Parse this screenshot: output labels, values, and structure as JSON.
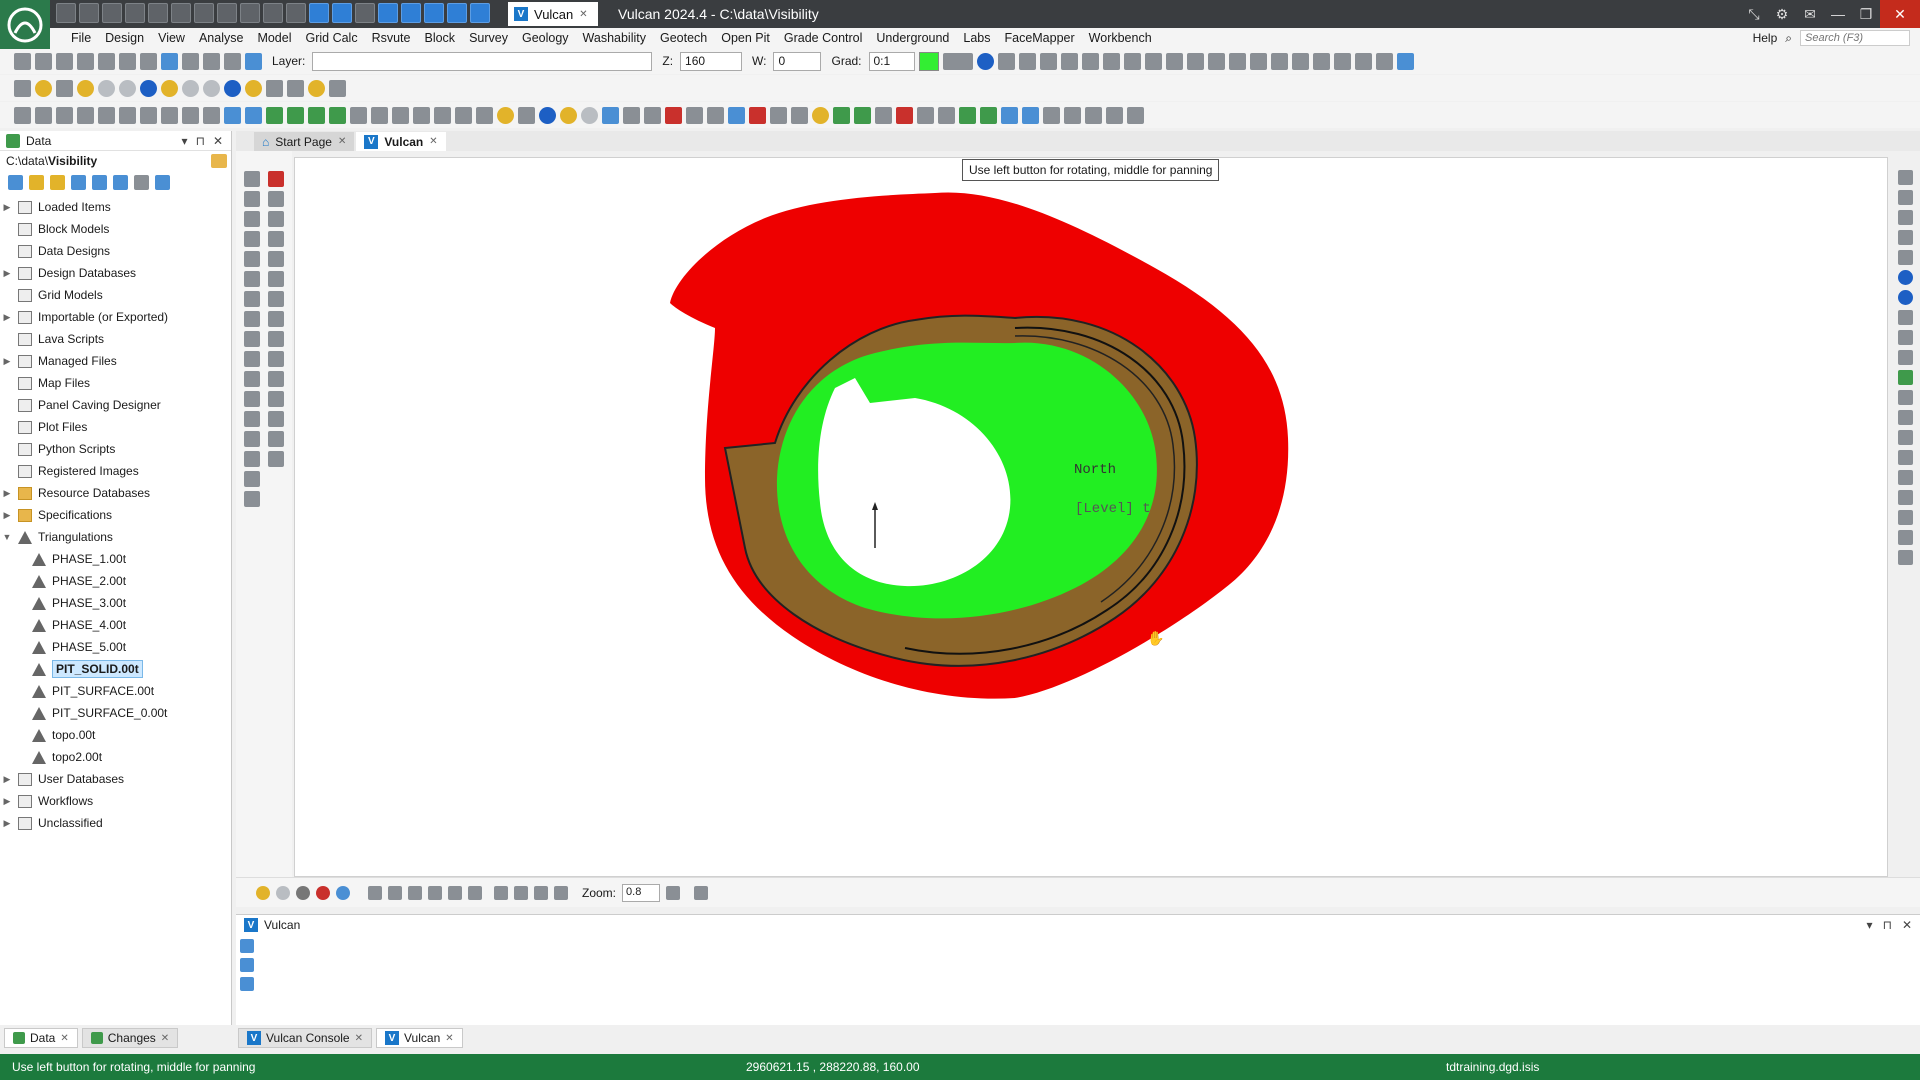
{
  "titlebar": {
    "quick_tab": "Vulcan",
    "title": "Vulcan 2024.4 - C:\\data\\Visibility",
    "close_glyph": "✕",
    "min_glyph": "—",
    "max_glyph": "❐"
  },
  "menu": {
    "items": [
      "File",
      "Design",
      "View",
      "Analyse",
      "Model",
      "Grid Calc",
      "Rsvute",
      "Block",
      "Survey",
      "Geology",
      "Washability",
      "Geotech",
      "Open Pit",
      "Grade Control",
      "Underground",
      "Labs",
      "FaceMapper",
      "Workbench"
    ],
    "help": "Help",
    "search_placeholder": "Search (F3)"
  },
  "toolbar": {
    "layer_label": "Layer:",
    "layer_value": "",
    "z_label": "Z:",
    "z_value": "160",
    "w_label": "W:",
    "w_value": "0",
    "grad_label": "Grad:",
    "grad_value": "0:1",
    "colour": "#33ee33"
  },
  "data_panel": {
    "title": "Data",
    "path_prefix": "C:\\data\\",
    "path_bold": "Visibility",
    "tree": [
      {
        "label": "Loaded Items",
        "expander": "▶",
        "icon": "loaded-items-icon"
      },
      {
        "label": "Block Models",
        "expander": "",
        "icon": "block-models-icon"
      },
      {
        "label": "Data Designs",
        "expander": "",
        "icon": "data-designs-icon"
      },
      {
        "label": "Design Databases",
        "expander": "▶",
        "icon": "design-databases-icon"
      },
      {
        "label": "Grid Models",
        "expander": "",
        "icon": "grid-models-icon"
      },
      {
        "label": "Importable (or Exported)",
        "expander": "▶",
        "icon": "importable-icon"
      },
      {
        "label": "Lava Scripts",
        "expander": "",
        "icon": "lava-scripts-icon"
      },
      {
        "label": "Managed Files",
        "expander": "▶",
        "icon": "managed-files-icon"
      },
      {
        "label": "Map Files",
        "expander": "",
        "icon": "map-files-icon"
      },
      {
        "label": "Panel Caving Designer",
        "expander": "",
        "icon": "panel-caving-icon"
      },
      {
        "label": "Plot Files",
        "expander": "",
        "icon": "plot-files-icon"
      },
      {
        "label": "Python Scripts",
        "expander": "",
        "icon": "python-scripts-icon"
      },
      {
        "label": "Registered Images",
        "expander": "",
        "icon": "registered-images-icon"
      },
      {
        "label": "Resource Databases",
        "expander": "▶",
        "icon": "resource-databases-icon"
      },
      {
        "label": "Specifications",
        "expander": "▶",
        "icon": "specifications-icon"
      },
      {
        "label": "Triangulations",
        "expander": "▼",
        "icon": "triangulations-icon"
      }
    ],
    "triangulations": [
      "PHASE_1.00t",
      "PHASE_2.00t",
      "PHASE_3.00t",
      "PHASE_4.00t",
      "PHASE_5.00t",
      "PIT_SOLID.00t",
      "PIT_SURFACE.00t",
      "PIT_SURFACE_0.00t",
      "topo.00t",
      "topo2.00t"
    ],
    "selected": "PIT_SOLID.00t",
    "tree_after": [
      {
        "label": "User Databases",
        "expander": "▶"
      },
      {
        "label": "Workflows",
        "expander": "▶"
      },
      {
        "label": "Unclassified",
        "expander": "▶"
      }
    ]
  },
  "doc_tabs": [
    {
      "label": "Start Page",
      "active": false
    },
    {
      "label": "Vulcan",
      "active": true
    }
  ],
  "viewport": {
    "tooltip": "Use left button for rotating, middle for panning",
    "north_label": "North",
    "axis_label": "[Level] t",
    "colors": {
      "outer": "#ee0000",
      "bench": "#8b6429",
      "floor": "#22ee22"
    }
  },
  "viewport_toolbar": {
    "zoom_label": "Zoom:",
    "zoom_value": "0.8"
  },
  "console": {
    "title": "Vulcan"
  },
  "bottom_tabs_left": [
    {
      "label": "Data",
      "active": true
    },
    {
      "label": "Changes",
      "active": false
    }
  ],
  "bottom_tabs_right": [
    {
      "label": "Vulcan Console",
      "active": false
    },
    {
      "label": "Vulcan",
      "active": true
    }
  ],
  "status": {
    "message": "Use left button for rotating, middle for panning",
    "coords": "2960621.15 , 288220.88, 160.00",
    "file": "tdtraining.dgd.isis"
  }
}
